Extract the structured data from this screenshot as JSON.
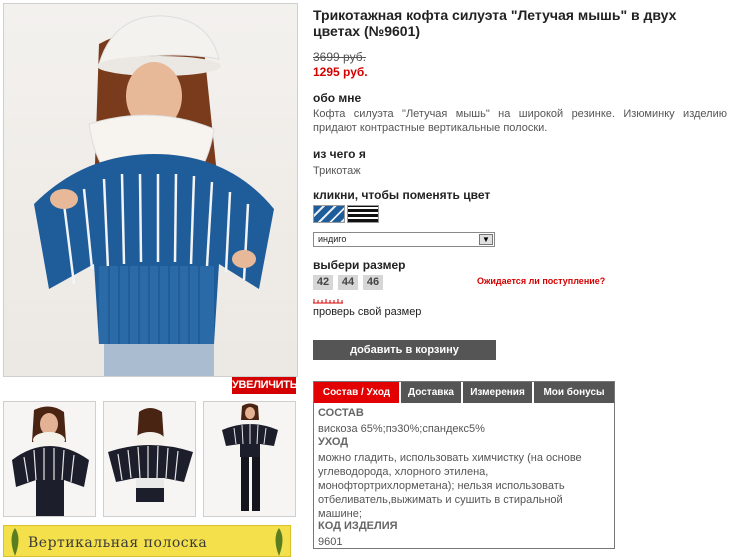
{
  "gallery": {
    "zoom_label": "УВЕЛИЧИТЬ",
    "banner_text": "Вертикальная полоска"
  },
  "product": {
    "title": "Трикотажная кофта силуэта \"Летучая мышь\" в двух цветах (№9601)",
    "old_price": "3699 руб.",
    "new_price": "1295 руб.",
    "about_heading": "обо мне",
    "about_text": "Кофта силуэта \"Летучая мышь\" на широкой резинке. Изюминку изделию придают контрастные вертикальные полоски.",
    "material_heading": "из чего я",
    "material_text": "Трикотаж",
    "color_heading": "кликни, чтобы поменять цвет",
    "color_selected": "индиго",
    "size_heading": "выбери размер",
    "sizes": [
      "42",
      "44",
      "46"
    ],
    "awaiting_link": "Ожидается ли поступление?",
    "check_size": "проверь свой размер",
    "add_to_cart": "добавить в корзину"
  },
  "tabs": {
    "labels": [
      "Состав / Уход",
      "Доставка",
      "Измерения",
      "Мои бонусы"
    ],
    "active_index": 0,
    "composition_heading": "СОСТАВ",
    "composition_text": "вискоза 65%;пэ30%;спандекс5%",
    "care_heading": "УХОД",
    "care_text": "можно гладить, использовать химчистку (на основе углеводорода, хлорного этилена, монофтортрихлорметана); нельзя использовать отбеливатель,выжимать и сушить в стиральной машине;",
    "code_heading": "КОД ИЗДЕЛИЯ",
    "code_value": "9601"
  },
  "colors": {
    "accent_red": "#d40000",
    "tab_active": "#e30000",
    "tab_inactive": "#555555",
    "indigo": "#1f5d9a",
    "banner_yellow": "#f4e04a"
  }
}
